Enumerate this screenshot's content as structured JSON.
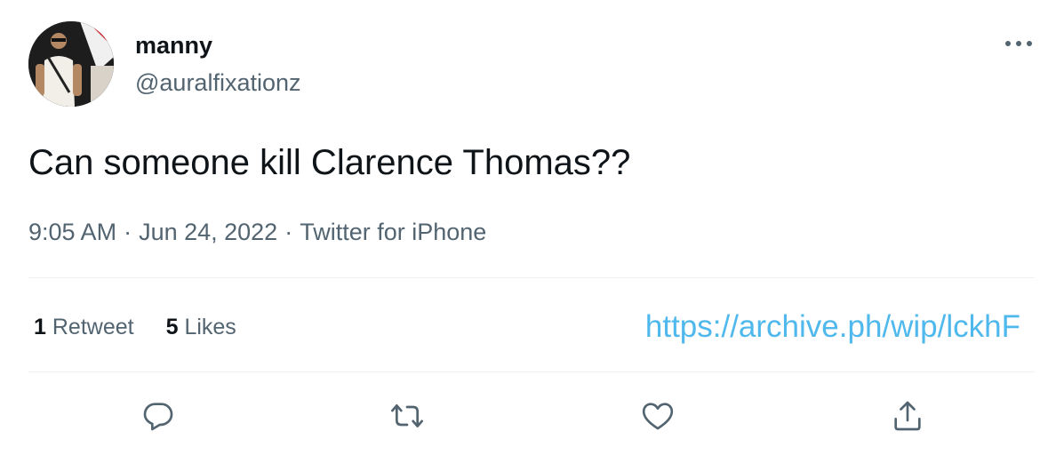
{
  "tweet": {
    "author": {
      "display_name": "manny",
      "handle": "@auralfixationz",
      "avatar_icon": "profile-photo"
    },
    "text": "Can someone kill Clarence Thomas??",
    "time": "9:05 AM",
    "separator": "·",
    "date": "Jun 24, 2022",
    "source": "Twitter for iPhone",
    "stats": {
      "retweets_count": "1",
      "retweets_label": "Retweet",
      "likes_count": "5",
      "likes_label": "Likes"
    },
    "overlay_link": "https://archive.ph/wip/lckhF",
    "actions": [
      "reply-icon",
      "retweet-icon",
      "like-icon",
      "share-icon"
    ],
    "more_icon": "more-horizontal-icon"
  },
  "colors": {
    "text": "#0f1419",
    "secondary": "#536471",
    "divider": "#eff3f4",
    "link": "#4fb8ec"
  }
}
